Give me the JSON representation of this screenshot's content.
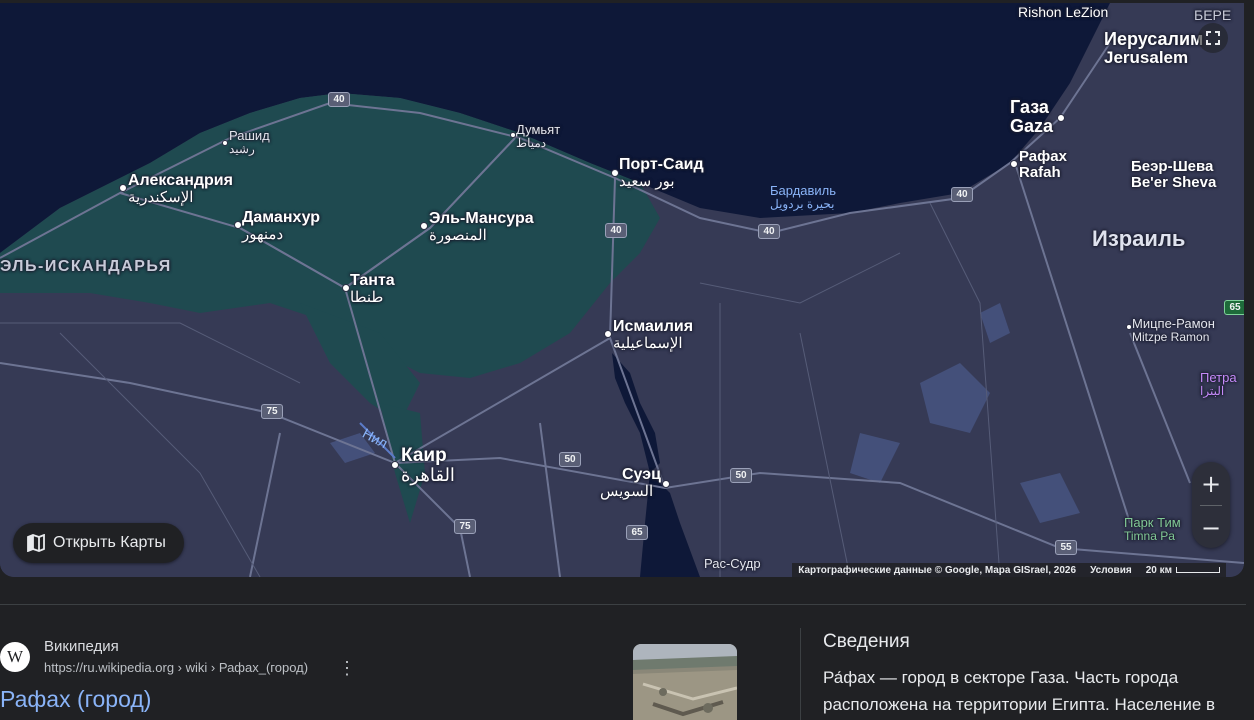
{
  "map": {
    "labels": {
      "rishon": "Rishon LeZion",
      "bere": "БЕРЕ",
      "jerusalem_ru": "Иерусалим",
      "jerusalem_en": "Jerusalem",
      "gaza_ru": "Газа",
      "gaza_en": "Gaza",
      "rafah_ru": "Рафах",
      "rafah_en": "Rafah",
      "beersheva_ru": "Беэр-Шева",
      "beersheva_en": "Be'er Sheva",
      "israel": "Израиль",
      "mitzpe_ru": "Мицпе-Рамон",
      "mitzpe_en": "Mitzpe Ramon",
      "petra_ru": "Петра",
      "petra_ar": "البترا",
      "timna_ru": "Парк Тим",
      "timna_en": "Timna Pa",
      "rashid_ru": "Рашид",
      "rashid_ar": "رشيد",
      "damietta_ru": "Думьят",
      "damietta_ar": "دمياط",
      "alexandria_ru": "Александрия",
      "alexandria_ar": "الإسكندرية",
      "portsaid_ru": "Порт-Саид",
      "portsaid_ar": "بور سعيد",
      "bardawil_ru": "Бардавиль",
      "bardawil_ar": "بحيرة بردويل",
      "damanhur_ru": "Даманхур",
      "damanhur_ar": "دمنهور",
      "mansoura_ru": "Эль-Мансура",
      "mansoura_ar": "المنصورة",
      "iskandaria": "ЭЛЬ-ИСКАНДАРЬЯ",
      "tanta_ru": "Танта",
      "tanta_ar": "طنطا",
      "ismailia_ru": "Исмаилия",
      "ismailia_ar": "الإسماعيلية",
      "nile": "Нил",
      "cairo_ru": "Каир",
      "cairo_ar": "القاهرة",
      "suez_ru": "Суэц",
      "suez_ar": "السويس",
      "rassudr": "Рас-Судр"
    },
    "road_shields": {
      "r40a": "40",
      "r40b": "40",
      "r40c": "40",
      "r40d": "40",
      "r75a": "75",
      "r75b": "75",
      "r50a": "50",
      "r50b": "50",
      "r65": "65",
      "r55": "55",
      "r65b": "65"
    },
    "open_maps_label": "Открыть Карты",
    "attribution": "Картографические данные © Google, Mapa GISrael, 2026",
    "terms": "Условия",
    "scale": "20 км",
    "zoom_in": "+",
    "zoom_out": "−",
    "colors": {
      "sea": "#0e1838",
      "land": "#363a55",
      "delta": "#1f4a50",
      "road": "#6d7493"
    }
  },
  "result": {
    "source_name": "Википедия",
    "source_url": "https://ru.wikipedia.org › wiki › Рафах_(город)",
    "title": "Рафах (город)",
    "icon_letter": "W"
  },
  "info": {
    "title": "Сведения",
    "text": "Ра́фах — город в секторе Газа. Часть города расположена на территории Египта. Население в"
  }
}
